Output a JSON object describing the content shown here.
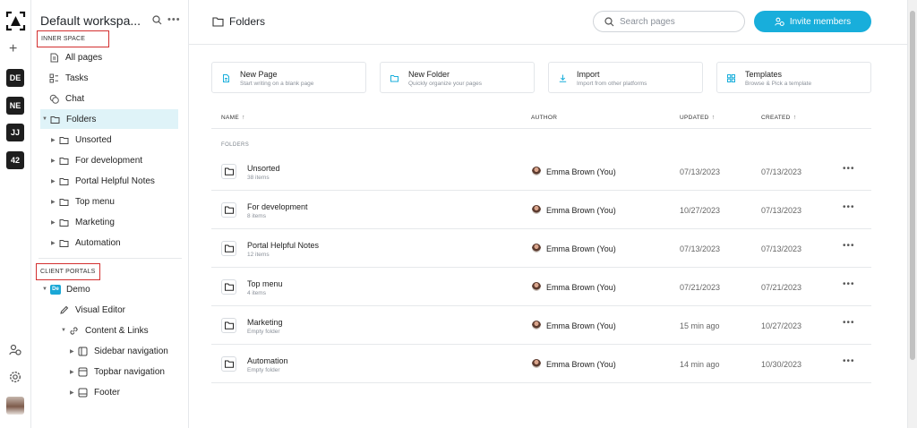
{
  "rail": {
    "workspaces": [
      "DE",
      "NE",
      "JJ",
      "42"
    ]
  },
  "sidebar": {
    "workspace_title": "Default workspa...",
    "inner_space_label": "INNER SPACE",
    "inner_items": [
      {
        "label": "All pages",
        "icon": "page-icon"
      },
      {
        "label": "Tasks",
        "icon": "tasks-icon"
      },
      {
        "label": "Chat",
        "icon": "chat-icon"
      },
      {
        "label": "Folders",
        "icon": "folder-icon",
        "active": true
      }
    ],
    "folders": [
      "Unsorted",
      "For development",
      "Portal Helpful Notes",
      "Top menu",
      "Marketing",
      "Automation"
    ],
    "client_portals_label": "CLIENT PORTALS",
    "portal": {
      "badge": "De",
      "name": "Demo",
      "visual_editor": "Visual Editor",
      "content_links": "Content & Links",
      "children": [
        "Sidebar navigation",
        "Topbar navigation",
        "Footer"
      ]
    }
  },
  "header": {
    "title": "Folders",
    "search_placeholder": "Search pages",
    "invite_label": "Invite members"
  },
  "cards": [
    {
      "title": "New Page",
      "subtitle": "Start writing on a blank page",
      "icon": "page-icon"
    },
    {
      "title": "New Folder",
      "subtitle": "Quickly organize your pages",
      "icon": "folder-icon"
    },
    {
      "title": "Import",
      "subtitle": "Import from other platforms",
      "icon": "download-icon"
    },
    {
      "title": "Templates",
      "subtitle": "Browse & Pick a template",
      "icon": "templates-icon"
    }
  ],
  "table": {
    "columns": {
      "name": "NAME",
      "author": "AUTHOR",
      "updated": "UPDATED",
      "created": "CREATED"
    },
    "group_label": "FOLDERS",
    "rows": [
      {
        "name": "Unsorted",
        "count": "38 items",
        "author": "Emma Brown (You)",
        "updated": "07/13/2023",
        "created": "07/13/2023"
      },
      {
        "name": "For development",
        "count": "8 items",
        "author": "Emma Brown (You)",
        "updated": "10/27/2023",
        "created": "07/13/2023"
      },
      {
        "name": "Portal Helpful Notes",
        "count": "12 items",
        "author": "Emma Brown (You)",
        "updated": "07/13/2023",
        "created": "07/13/2023"
      },
      {
        "name": "Top menu",
        "count": "4 items",
        "author": "Emma Brown (You)",
        "updated": "07/21/2023",
        "created": "07/21/2023"
      },
      {
        "name": "Marketing",
        "count": "Empty folder",
        "author": "Emma Brown (You)",
        "updated": "15 min ago",
        "created": "10/27/2023"
      },
      {
        "name": "Automation",
        "count": "Empty folder",
        "author": "Emma Brown (You)",
        "updated": "14 min ago",
        "created": "10/30/2023"
      }
    ]
  },
  "colors": {
    "accent": "#18aedb",
    "active_bg": "#dff3f8",
    "highlight_border": "#d32f2f"
  }
}
